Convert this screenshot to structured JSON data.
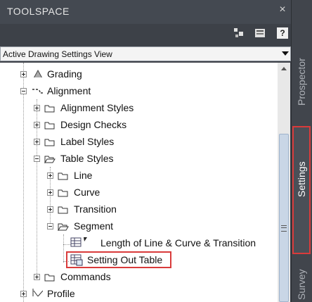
{
  "window": {
    "title": "TOOLSPACE",
    "close_glyph": "×"
  },
  "toolbar": {
    "help_label": "?"
  },
  "view_select": {
    "value": "Active Drawing Settings View"
  },
  "tree": [
    {
      "label": "Grading"
    },
    {
      "label": "Alignment"
    },
    {
      "label": "Alignment Styles"
    },
    {
      "label": "Design Checks"
    },
    {
      "label": "Label Styles"
    },
    {
      "label": "Table Styles"
    },
    {
      "label": "Line"
    },
    {
      "label": "Curve"
    },
    {
      "label": "Transition"
    },
    {
      "label": "Segment"
    },
    {
      "label": "Length of Line & Curve & Transition"
    },
    {
      "label": "Setting Out Table"
    },
    {
      "label": "Commands"
    },
    {
      "label": "Profile"
    }
  ],
  "side_tabs": {
    "prospector": "Prospector",
    "settings": "Settings",
    "survey": "Survey"
  },
  "colors": {
    "highlight_border": "#d93b3b",
    "panel_bg": "#3d4148"
  }
}
